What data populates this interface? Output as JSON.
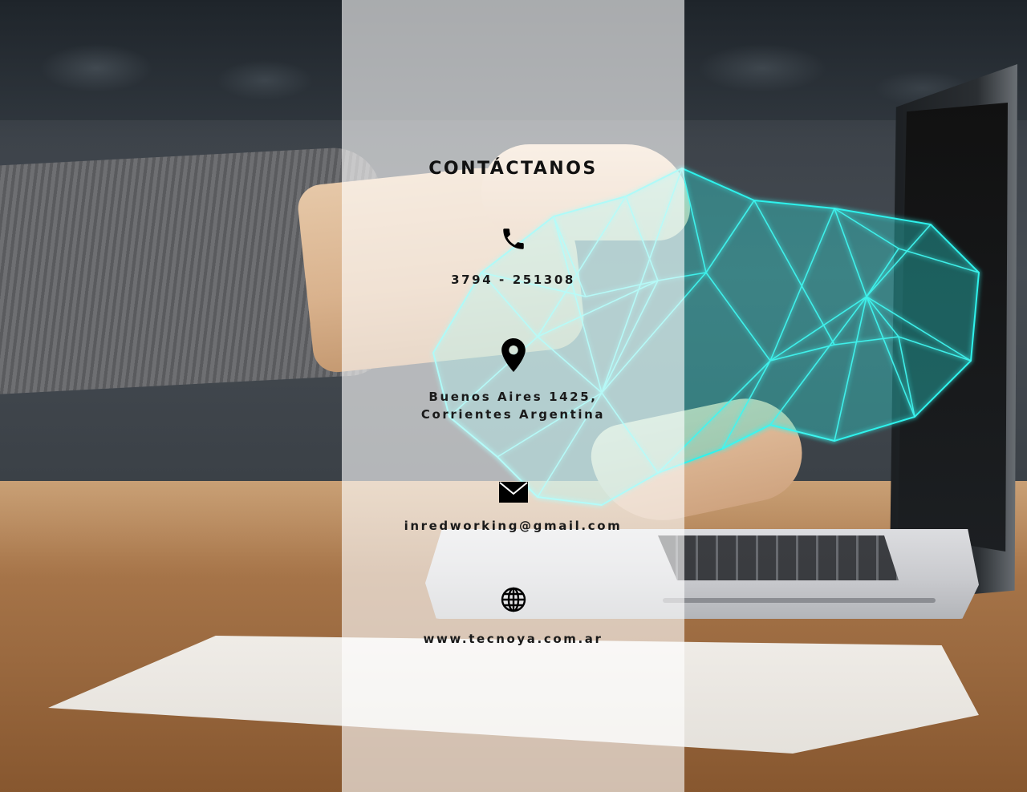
{
  "contact": {
    "title": "CONTÁCTANOS",
    "phone": {
      "icon": "phone-icon",
      "value": "3794 - 251308"
    },
    "address": {
      "icon": "location-pin-icon",
      "line1": "Buenos Aires 1425,",
      "line2": "Corrientes Argentina"
    },
    "email": {
      "icon": "envelope-icon",
      "value": "inredworking@gmail.com"
    },
    "website": {
      "icon": "globe-icon",
      "value": "www.tecnoya.com.ar"
    }
  },
  "colors": {
    "accent": "#2ef2ec",
    "text": "#111111",
    "panel": "rgba(255,255,255,0.62)"
  }
}
